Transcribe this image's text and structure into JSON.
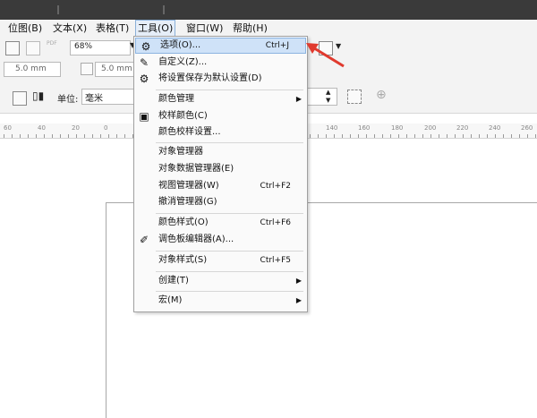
{
  "menubar": {
    "items": [
      "位图(B)",
      "文本(X)",
      "表格(T)",
      "工具(O)",
      "窗口(W)",
      "帮助(H)"
    ]
  },
  "toolbar1": {
    "pdf_label": "PDF",
    "zoom_value": "68%"
  },
  "toolbar2": {
    "nudge1": "5.0 mm",
    "nudge2": "5.0 mm"
  },
  "toolbar3": {
    "units_label": "单位:",
    "units_value": "毫米"
  },
  "ruler": {
    "left_labels": [
      "60",
      "40",
      "20",
      "0"
    ],
    "right_labels": [
      "140",
      "160",
      "180",
      "200",
      "220",
      "240",
      "260"
    ]
  },
  "tools_menu": {
    "items": [
      {
        "label": "选项(O)...",
        "shortcut": "Ctrl+J",
        "icon": "gear-icon"
      },
      {
        "label": "自定义(Z)...",
        "icon": "customize-icon"
      },
      {
        "label": "将设置保存为默认设置(D)",
        "icon": "save-gear-icon"
      },
      {
        "label": "颜色管理"
      },
      {
        "label": "校样颜色(C)",
        "icon": "monitor-icon"
      },
      {
        "label": "颜色校样设置..."
      },
      {
        "label": "对象管理器"
      },
      {
        "label": "对象数据管理器(E)"
      },
      {
        "label": "视图管理器(W)",
        "shortcut": "Ctrl+F2"
      },
      {
        "label": "撤消管理器(G)"
      },
      {
        "label": "颜色样式(O)",
        "shortcut": "Ctrl+F6"
      },
      {
        "label": "调色板编辑器(A)...",
        "icon": "palette-edit-icon"
      },
      {
        "label": "对象样式(S)",
        "shortcut": "Ctrl+F5"
      },
      {
        "label": "创建(T)"
      },
      {
        "label": "宏(M)"
      }
    ]
  },
  "colors": {
    "highlight": "#cfe2f8",
    "arrow": "#e03a2e"
  }
}
